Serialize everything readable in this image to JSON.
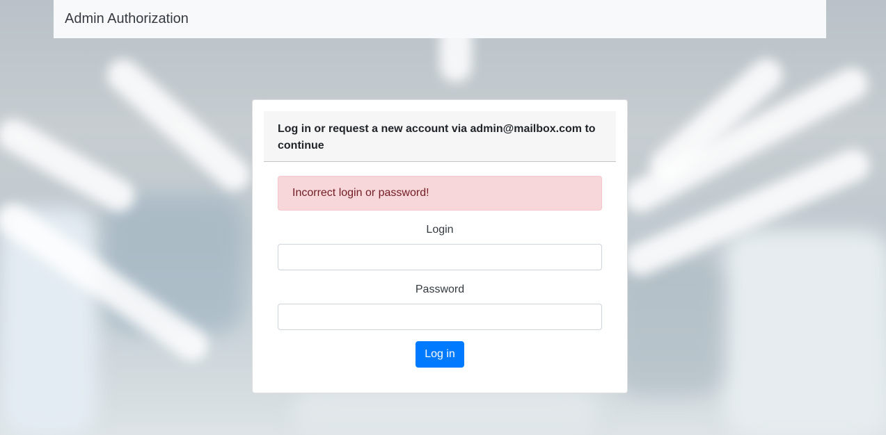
{
  "navbar": {
    "brand": "Admin Authorization"
  },
  "card": {
    "header": "Log in or request a new account via admin@mailbox.com to continue",
    "alert": "Incorrect login or password!",
    "login_label": "Login",
    "login_value": "",
    "password_label": "Password",
    "password_value": "",
    "submit_label": "Log in"
  },
  "colors": {
    "navbar_bg": "#f8f9fa",
    "alert_bg": "#f8d7da",
    "alert_text": "#721c24",
    "primary": "#007bff"
  }
}
